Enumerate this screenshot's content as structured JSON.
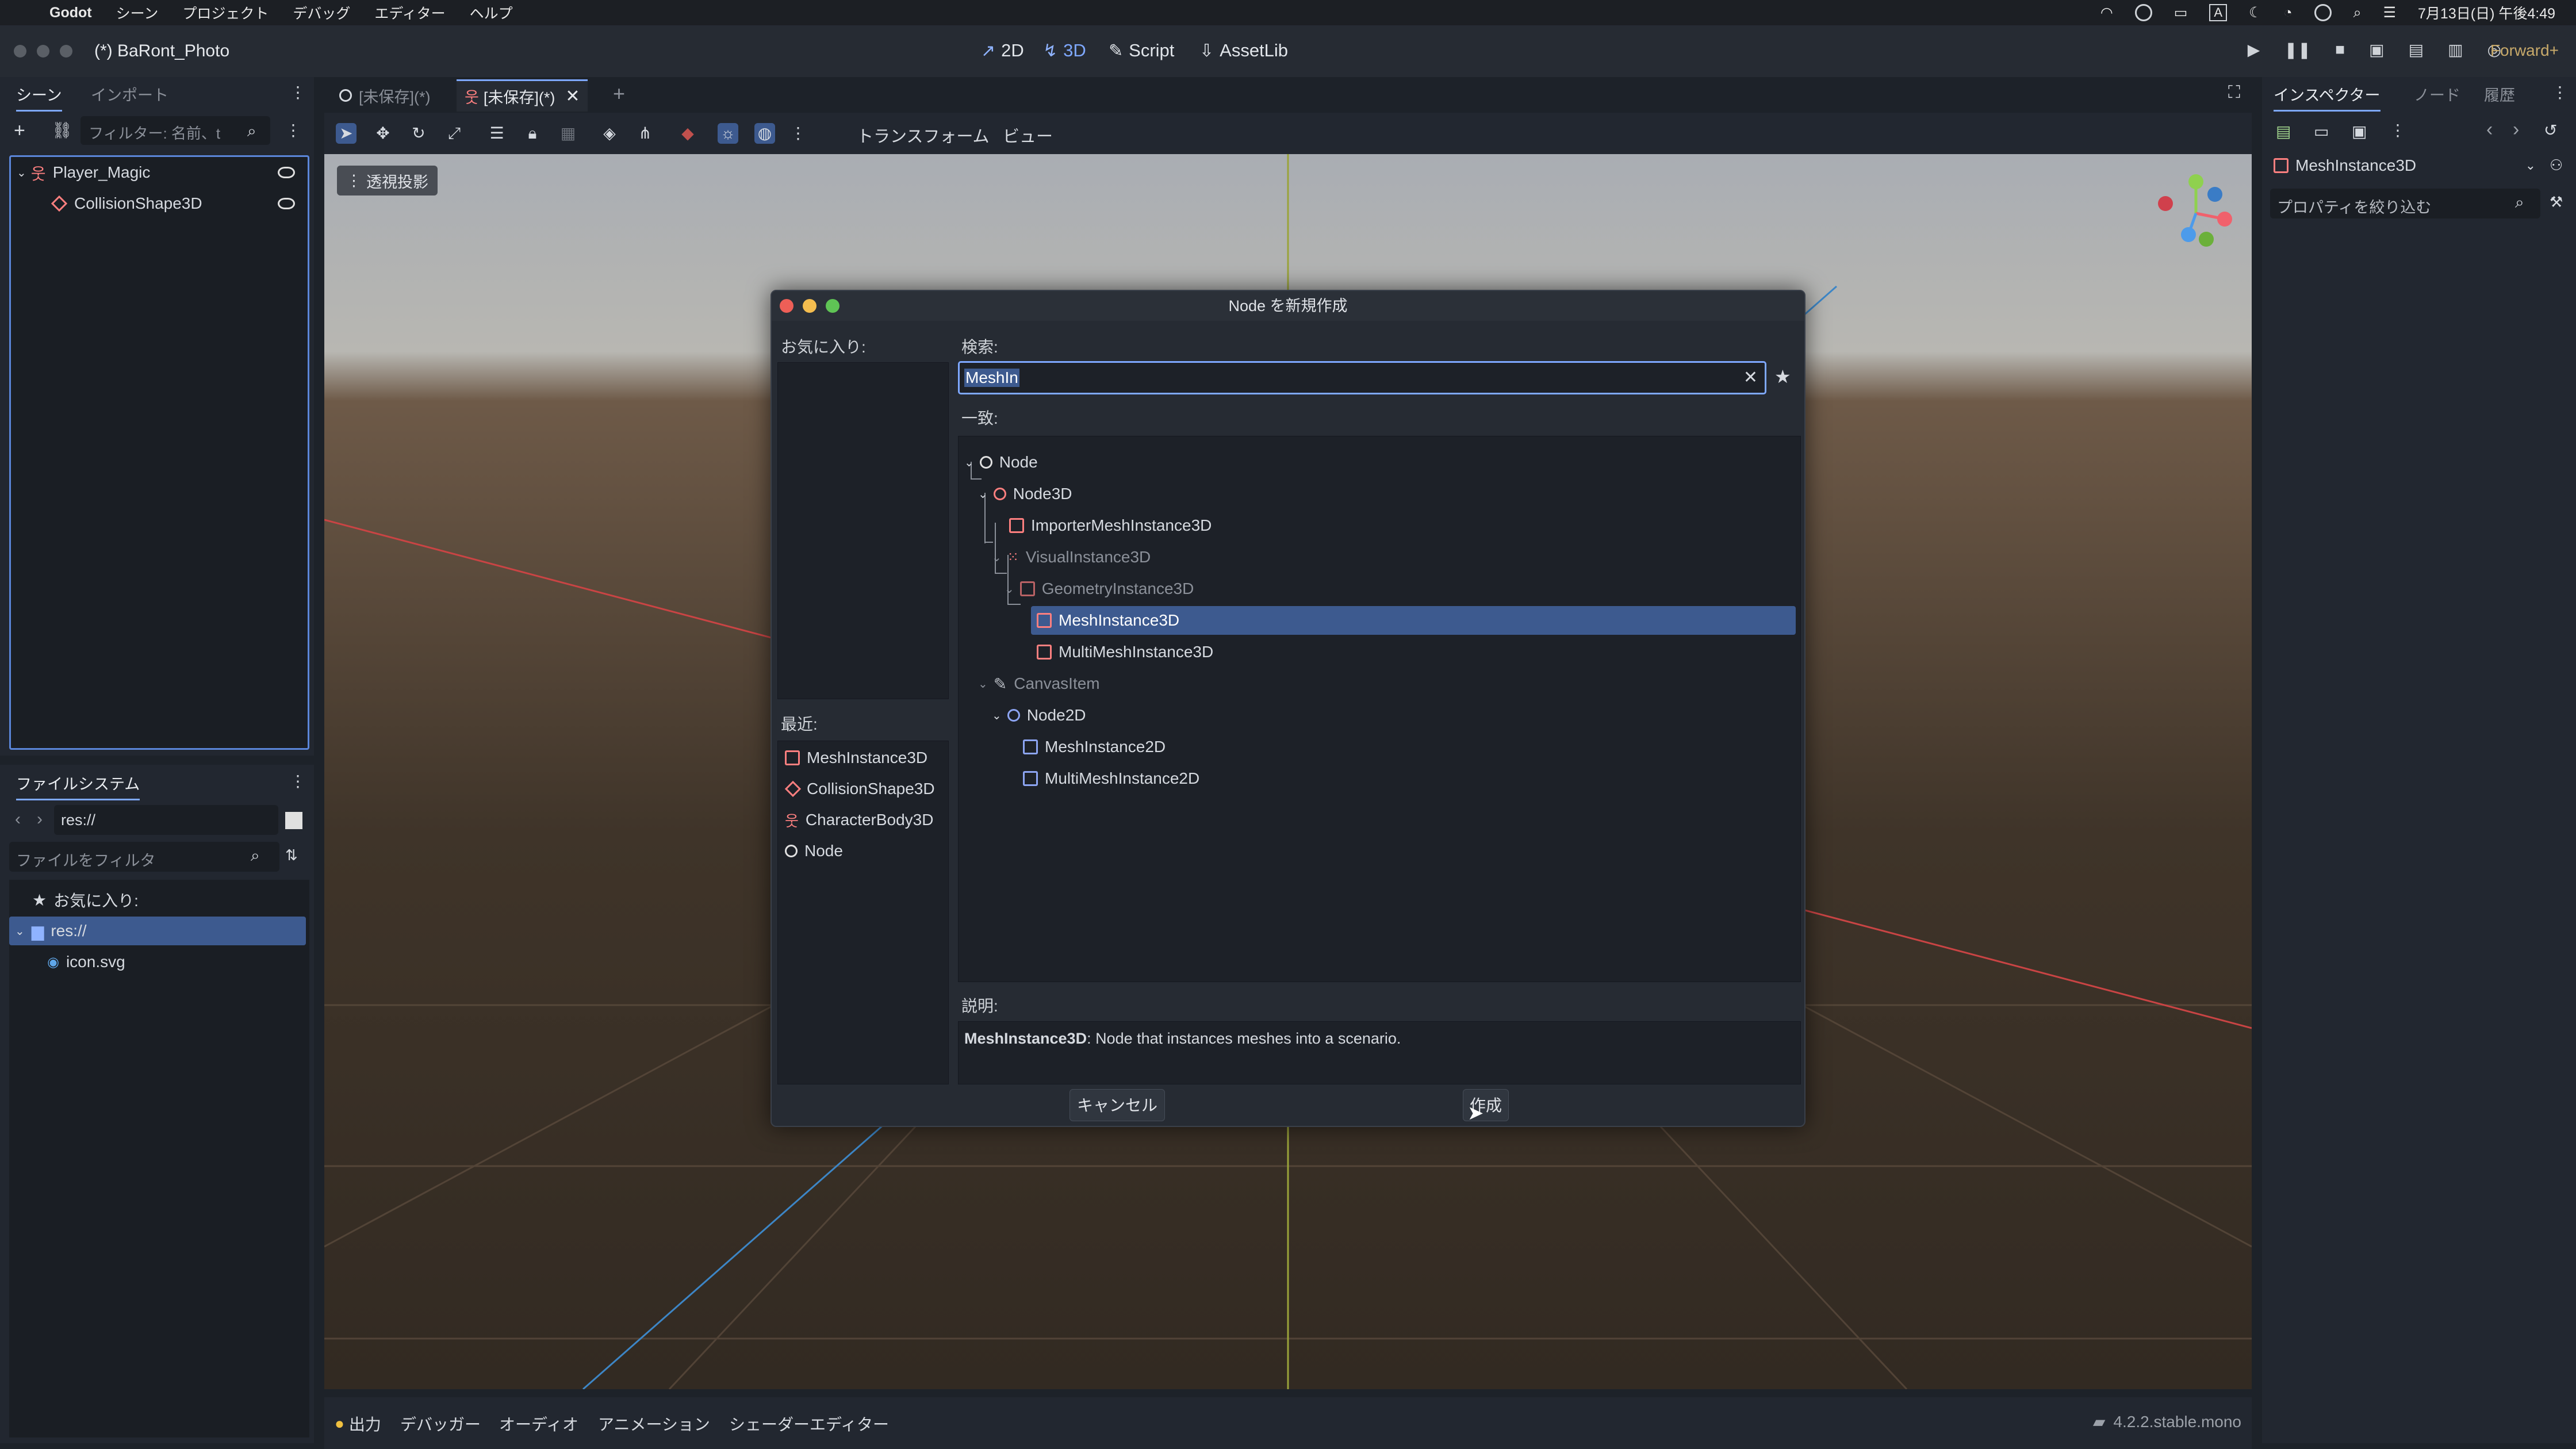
{
  "menubar": {
    "app": "Godot",
    "items": [
      "シーン",
      "プロジェクト",
      "デバッグ",
      "エディター",
      "ヘルプ"
    ],
    "clock": "7月13日(日) 午後4:49",
    "input_indicator": "A"
  },
  "titlebar": {
    "project_title": "(*) BaRont_Photo",
    "modes": [
      "2D",
      "3D",
      "Script",
      "AssetLib"
    ],
    "active_mode": "3D",
    "renderer": "Forward+"
  },
  "scene_dock": {
    "tabs": [
      "シーン",
      "インポート"
    ],
    "filter_placeholder": "フィルター: 名前、t",
    "nodes": [
      {
        "name": "Player_Magic",
        "type": "CharacterBody3D"
      },
      {
        "name": "CollisionShape3D",
        "type": "CollisionShape3D"
      }
    ]
  },
  "filesystem_dock": {
    "title": "ファイルシステム",
    "path": "res://",
    "filter_placeholder": "ファイルをフィルタ",
    "items": [
      {
        "name": "お気に入り:",
        "kind": "favorites"
      },
      {
        "name": "res://",
        "kind": "folder"
      },
      {
        "name": "icon.svg",
        "kind": "file"
      }
    ]
  },
  "editor_tabs": [
    "[未保存](*)",
    "[未保存](*)"
  ],
  "viewport_toolbar": {
    "transform_menu": "トランスフォーム",
    "view_menu": "ビュー",
    "perspective_label": "透視投影"
  },
  "dialog": {
    "title": "Node を新規作成",
    "favorites_label": "お気に入り:",
    "recent_label": "最近:",
    "recent_items": [
      "MeshInstance3D",
      "CollisionShape3D",
      "CharacterBody3D",
      "Node"
    ],
    "search_label": "検索:",
    "search_value": "MeshIn",
    "matches_label": "一致:",
    "tree": [
      {
        "label": "Node",
        "indent": 0,
        "dim": false,
        "icon": "circle-white"
      },
      {
        "label": "Node3D",
        "indent": 1,
        "dim": false,
        "icon": "circle-red"
      },
      {
        "label": "ImporterMeshInstance3D",
        "indent": 2,
        "dim": false,
        "icon": "mesh-red"
      },
      {
        "label": "VisualInstance3D",
        "indent": 2,
        "dim": true,
        "icon": "visual-red"
      },
      {
        "label": "GeometryInstance3D",
        "indent": 3,
        "dim": true,
        "icon": "mesh-red"
      },
      {
        "label": "MeshInstance3D",
        "indent": 4,
        "dim": false,
        "icon": "mesh-red",
        "selected": true
      },
      {
        "label": "MultiMeshInstance3D",
        "indent": 4,
        "dim": false,
        "icon": "mesh-red"
      },
      {
        "label": "CanvasItem",
        "indent": 1,
        "dim": true,
        "icon": "pencil"
      },
      {
        "label": "Node2D",
        "indent": 2,
        "dim": false,
        "icon": "circle-blue"
      },
      {
        "label": "MeshInstance2D",
        "indent": 3,
        "dim": false,
        "icon": "mesh-blue"
      },
      {
        "label": "MultiMeshInstance2D",
        "indent": 3,
        "dim": false,
        "icon": "mesh-blue"
      }
    ],
    "description_label": "説明:",
    "description_class": "MeshInstance3D",
    "description_text": ": Node that instances meshes into a scenario.",
    "cancel_label": "キャンセル",
    "create_label": "作成"
  },
  "bottom_panel": {
    "tabs": [
      "出力",
      "デバッガー",
      "オーディオ",
      "アニメーション",
      "シェーダーエディター"
    ],
    "version": "4.2.2.stable.mono"
  },
  "inspector": {
    "tabs": [
      "インスペクター",
      "ノード",
      "履歴"
    ],
    "node_name": "MeshInstance3D",
    "filter_placeholder": "プロパティを絞り込む"
  },
  "colors": {
    "accent": "#7ea8ff",
    "selection": "#3d5a8f",
    "node3d_icon": "#fc7f7f",
    "node2d_icon": "#8da5f3"
  }
}
